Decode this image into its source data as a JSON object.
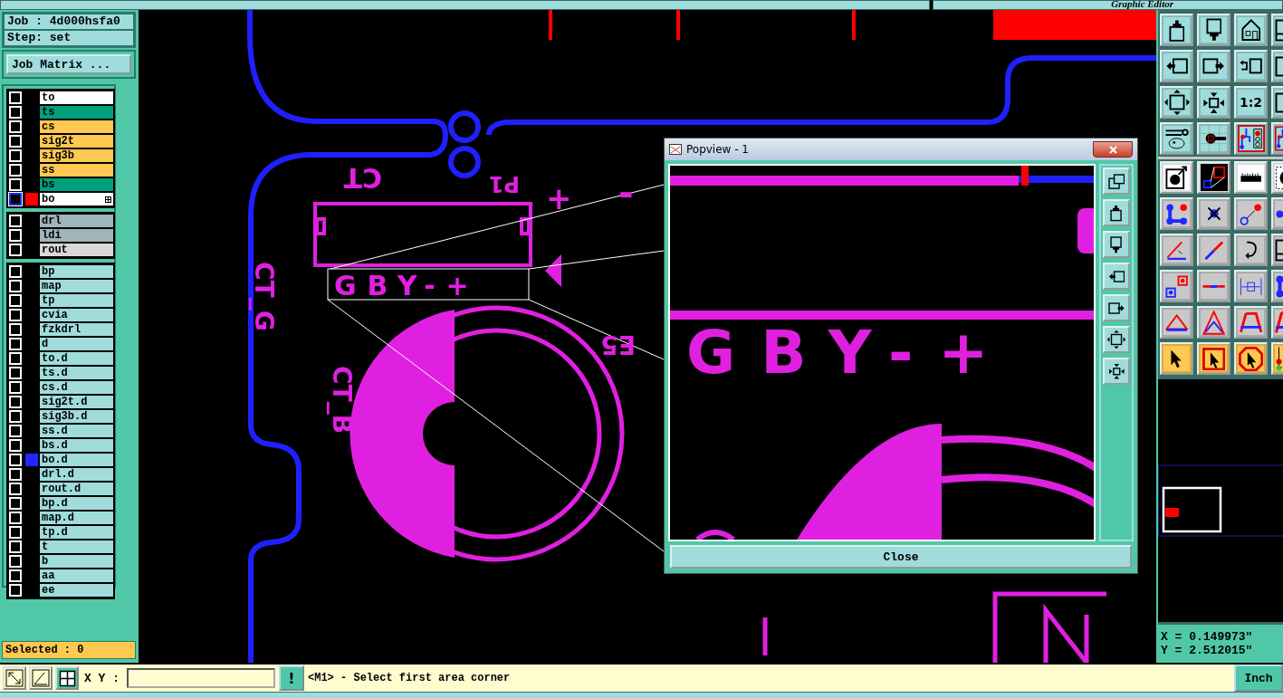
{
  "title_bar": {
    "title": "Graphic Editor"
  },
  "job": {
    "job": "Job : 4d000hsfa0",
    "step": "Step: set",
    "matrix_button": "Job Matrix ..."
  },
  "layer_groups": [
    [
      {
        "name": "to",
        "color": "#ffffff",
        "selected": false
      },
      {
        "name": "ts",
        "color": "#00a07c",
        "selected": false
      },
      {
        "name": "cs",
        "color": "#ffc850",
        "selected": false
      },
      {
        "name": "sig2t",
        "color": "#ffc850",
        "selected": false
      },
      {
        "name": "sig3b",
        "color": "#ffc850",
        "selected": false
      },
      {
        "name": "ss",
        "color": "#ffc850",
        "selected": false
      },
      {
        "name": "bs",
        "color": "#00a07c",
        "selected": false
      },
      {
        "name": "bo",
        "color": "#ffffff",
        "selected": true,
        "marker": {
          "color": "#ff0000"
        }
      }
    ],
    [
      {
        "name": "drl",
        "color": "#a0b4bc",
        "selected": false
      },
      {
        "name": "ldi",
        "color": "#a0b4bc",
        "selected": false
      },
      {
        "name": "rout",
        "color": "#d8d8d8",
        "selected": false
      }
    ],
    [
      {
        "name": "bp",
        "color": "#a0dcdc",
        "selected": false
      },
      {
        "name": "map",
        "color": "#a0dcdc",
        "selected": false
      },
      {
        "name": "tp",
        "color": "#a0dcdc",
        "selected": false
      },
      {
        "name": "cvia",
        "color": "#a0dcdc",
        "selected": false
      },
      {
        "name": "fzkdrl",
        "color": "#a0dcdc",
        "selected": false
      },
      {
        "name": "d",
        "color": "#a0dcdc",
        "selected": false
      },
      {
        "name": "to.d",
        "color": "#a0dcdc",
        "selected": false
      },
      {
        "name": "ts.d",
        "color": "#a0dcdc",
        "selected": false
      },
      {
        "name": "cs.d",
        "color": "#a0dcdc",
        "selected": false
      },
      {
        "name": "sig2t.d",
        "color": "#a0dcdc",
        "selected": false
      },
      {
        "name": "sig3b.d",
        "color": "#a0dcdc",
        "selected": false
      },
      {
        "name": "ss.d",
        "color": "#a0dcdc",
        "selected": false
      },
      {
        "name": "bs.d",
        "color": "#a0dcdc",
        "selected": false
      },
      {
        "name": "bo.d",
        "color": "#a0dcdc",
        "selected": false,
        "marker": {
          "color": "#1e28ff"
        }
      },
      {
        "name": "drl.d",
        "color": "#a0dcdc",
        "selected": false
      },
      {
        "name": "rout.d",
        "color": "#a0dcdc",
        "selected": false
      },
      {
        "name": "bp.d",
        "color": "#a0dcdc",
        "selected": false
      },
      {
        "name": "map.d",
        "color": "#a0dcdc",
        "selected": false
      },
      {
        "name": "tp.d",
        "color": "#a0dcdc",
        "selected": false
      },
      {
        "name": "t",
        "color": "#a0dcdc",
        "selected": false
      },
      {
        "name": "b",
        "color": "#a0dcdc",
        "selected": false
      },
      {
        "name": "aa",
        "color": "#a0dcdc",
        "selected": false
      },
      {
        "name": "ee",
        "color": "#a0dcdc",
        "selected": false
      }
    ]
  ],
  "selected_count": "Selected : 0",
  "canvas": {
    "labels": [
      "CT",
      "P1",
      "+",
      "-",
      "GBY-+",
      "CT_G",
      "CT_B",
      "E5"
    ]
  },
  "popview": {
    "title": "Popview - 1",
    "label": "GBY-+",
    "close_button": "Close"
  },
  "toolbar": {
    "ratio_label": "1:2"
  },
  "coordinates": {
    "x": "X = 0.149973\"",
    "y": "Y = 2.512015\""
  },
  "bottom_bar": {
    "xy_label": "X Y :",
    "warning_button": "!",
    "message": "<M1> - Select first area corner",
    "units_button": "Inch"
  }
}
